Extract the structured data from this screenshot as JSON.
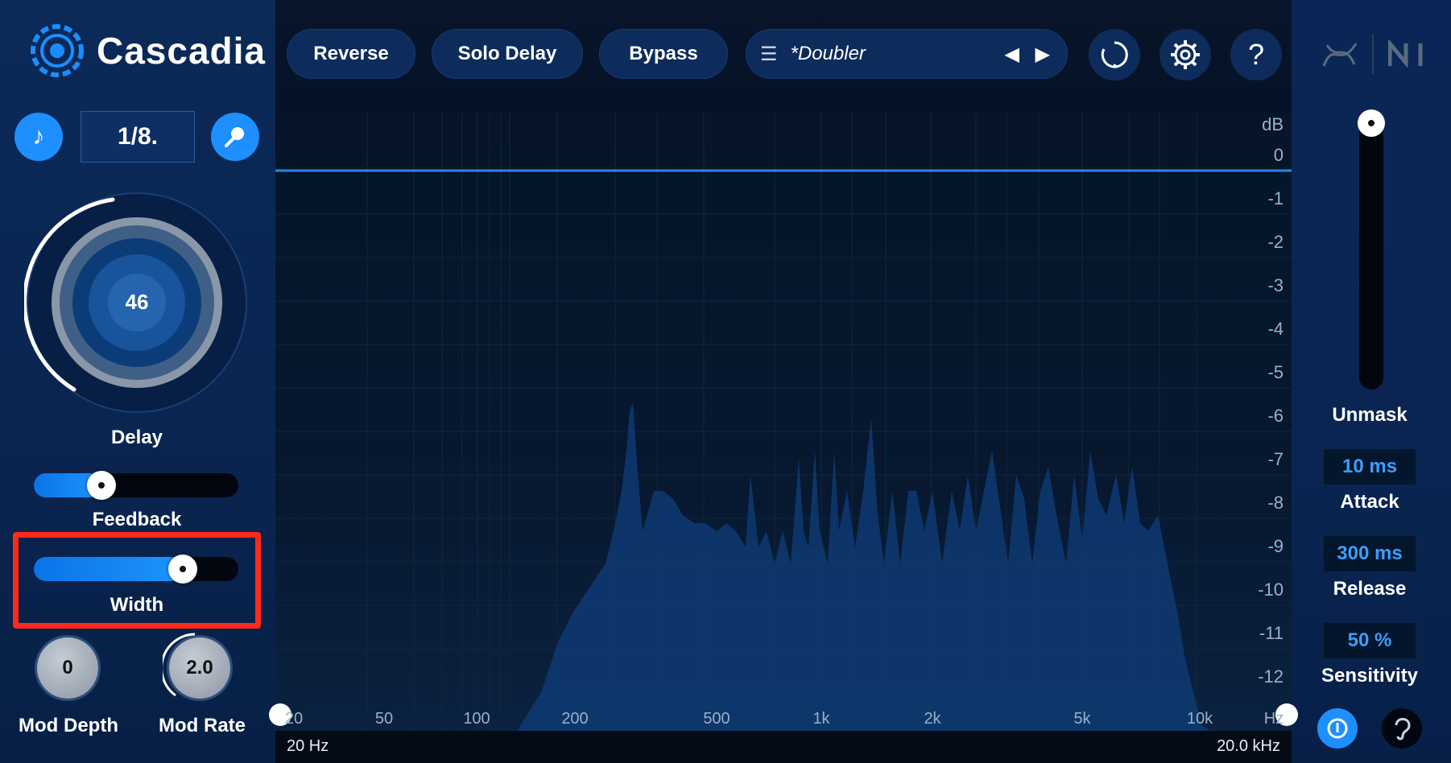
{
  "app": {
    "title": "Cascadia"
  },
  "header": {
    "reverse_label": "Reverse",
    "solo_delay_label": "Solo Delay",
    "bypass_label": "Bypass",
    "preset_name": "*Doubler"
  },
  "left": {
    "sync_value": "1/8.",
    "delay_value": "46",
    "delay_label": "Delay",
    "feedback_label": "Feedback",
    "feedback_level": 0.33,
    "width_label": "Width",
    "width_level": 0.73,
    "mod_depth_value": "0",
    "mod_depth_label": "Mod Depth",
    "mod_rate_value": "2.0",
    "mod_rate_label": "Mod Rate"
  },
  "right": {
    "unmask_label": "Unmask",
    "attack_value": "10 ms",
    "attack_label": "Attack",
    "release_value": "300 ms",
    "release_label": "Release",
    "sensitivity_value": "50 %",
    "sensitivity_label": "Sensitivity"
  },
  "spectrum": {
    "db_unit": "dB",
    "db_ticks": [
      "0",
      "-1",
      "-2",
      "-3",
      "-4",
      "-5",
      "-6",
      "-7",
      "-8",
      "-9",
      "-10",
      "-11",
      "-12"
    ],
    "hz_ticks": [
      "20",
      "50",
      "100",
      "200",
      "500",
      "1k",
      "2k",
      "5k",
      "10k",
      "Hz"
    ],
    "range_low": "20 Hz",
    "range_high": "20.0 kHz"
  },
  "colors": {
    "accent": "#1d8fff",
    "highlight": "#ff2a1a",
    "panel": "#0b2a58"
  },
  "icons": {
    "logo": "cascadia-logo-icon",
    "note": "music-note-icon",
    "pin": "pin-icon",
    "prev": "prev-preset-icon",
    "next": "next-preset-icon",
    "list": "preset-list-icon",
    "loop": "loop-icon",
    "settings": "gear-icon",
    "help": "help-icon",
    "izotope": "izotope-logo-icon",
    "ni": "ni-logo-icon",
    "power": "power-icon",
    "ear": "ear-icon"
  }
}
